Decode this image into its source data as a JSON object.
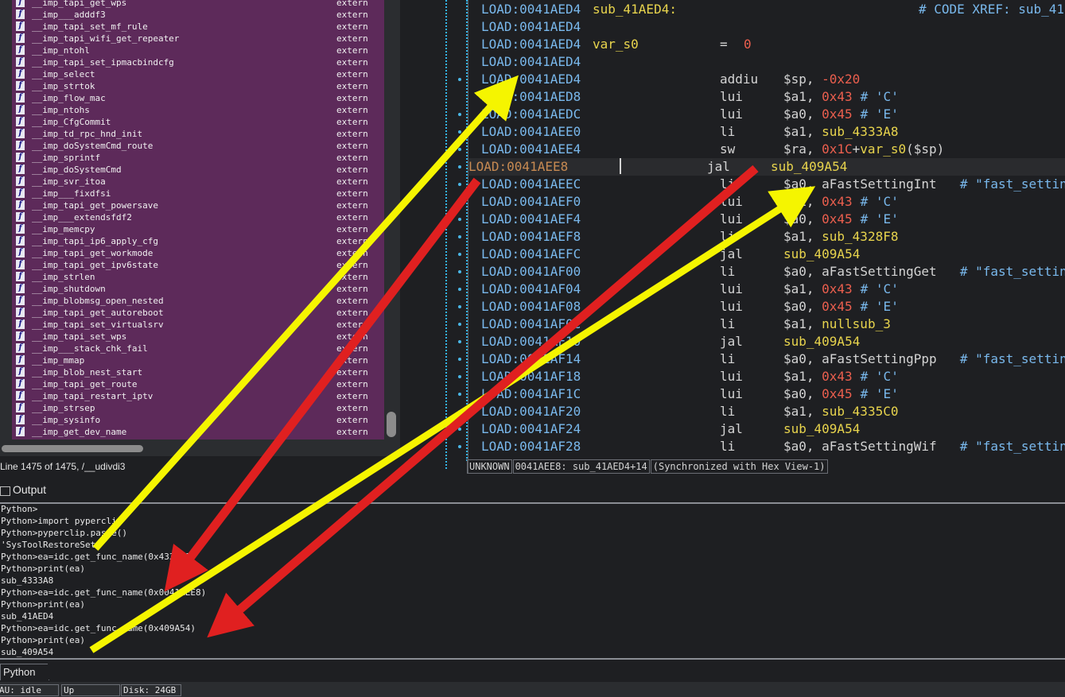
{
  "functions": {
    "rows": [
      {
        "name": "__imp_tapi_get_wps",
        "segment": "extern"
      },
      {
        "name": "__imp___adddf3",
        "segment": "extern"
      },
      {
        "name": "__imp_tapi_set_mf_rule",
        "segment": "extern"
      },
      {
        "name": "__imp_tapi_wifi_get_repeater",
        "segment": "extern"
      },
      {
        "name": "__imp_ntohl",
        "segment": "extern"
      },
      {
        "name": "__imp_tapi_set_ipmacbindcfg",
        "segment": "extern"
      },
      {
        "name": "__imp_select",
        "segment": "extern"
      },
      {
        "name": "__imp_strtok",
        "segment": "extern"
      },
      {
        "name": "__imp_flow_mac",
        "segment": "extern"
      },
      {
        "name": "__imp_ntohs",
        "segment": "extern"
      },
      {
        "name": "__imp_CfgCommit",
        "segment": "extern"
      },
      {
        "name": "__imp_td_rpc_hnd_init",
        "segment": "extern"
      },
      {
        "name": "__imp_doSystemCmd_route",
        "segment": "extern"
      },
      {
        "name": "__imp_sprintf",
        "segment": "extern"
      },
      {
        "name": "__imp_doSystemCmd",
        "segment": "extern"
      },
      {
        "name": "__imp_svr_itoa",
        "segment": "extern"
      },
      {
        "name": "__imp___fixdfsi",
        "segment": "extern"
      },
      {
        "name": "__imp_tapi_get_powersave",
        "segment": "extern"
      },
      {
        "name": "__imp___extendsfdf2",
        "segment": "extern"
      },
      {
        "name": "__imp_memcpy",
        "segment": "extern"
      },
      {
        "name": "__imp_tapi_ip6_apply_cfg",
        "segment": "extern"
      },
      {
        "name": "__imp_tapi_get_workmode",
        "segment": "extern"
      },
      {
        "name": "__imp_tapi_get_ipv6state",
        "segment": "extern"
      },
      {
        "name": "__imp_strlen",
        "segment": "extern"
      },
      {
        "name": "__imp_shutdown",
        "segment": "extern"
      },
      {
        "name": "__imp_blobmsg_open_nested",
        "segment": "extern"
      },
      {
        "name": "__imp_tapi_get_autoreboot",
        "segment": "extern"
      },
      {
        "name": "__imp_tapi_set_virtualsrv",
        "segment": "extern"
      },
      {
        "name": "__imp_tapi_set_wps",
        "segment": "extern"
      },
      {
        "name": "__imp___stack_chk_fail",
        "segment": "extern"
      },
      {
        "name": "__imp_mmap",
        "segment": "extern"
      },
      {
        "name": "__imp_blob_nest_start",
        "segment": "extern"
      },
      {
        "name": "__imp_tapi_get_route",
        "segment": "extern"
      },
      {
        "name": "__imp_tapi_restart_iptv",
        "segment": "extern"
      },
      {
        "name": "__imp_strsep",
        "segment": "extern"
      },
      {
        "name": "__imp_sysinfo",
        "segment": "extern"
      },
      {
        "name": "__imp_get_dev_name",
        "segment": "extern"
      }
    ],
    "line_info": "Line 1475 of 1475, /__udivdi3"
  },
  "disasm": {
    "lines": [
      {
        "addr": "LOAD:0041AED4",
        "label": "sub_41AED4:",
        "comment": "# CODE XREF: sub_41"
      },
      {
        "addr": "LOAD:0041AED4"
      },
      {
        "addr": "LOAD:0041AED4",
        "label": "var_s0",
        "mnem": "=",
        "num": "0"
      },
      {
        "addr": "LOAD:0041AED4"
      },
      {
        "addr": "LOAD:0041AED4",
        "mnem": "addiu",
        "op": "$sp, ",
        "num": "-0x20"
      },
      {
        "addr": "LOAD:0041AED8",
        "mnem": "lui",
        "op": "$a1, ",
        "num": "0x43",
        "comment": "# 'C'"
      },
      {
        "addr": "LOAD:0041AEDC",
        "mnem": "lui",
        "op": "$a0, ",
        "num": "0x45",
        "comment": "# 'E'"
      },
      {
        "addr": "LOAD:0041AEE0",
        "mnem": "li",
        "op": "$a1, ",
        "sym": "sub_4333A8"
      },
      {
        "addr": "LOAD:0041AEE4",
        "mnem": "sw",
        "op": "$ra, ",
        "num": "0x1C",
        "op2": "+",
        "sym": "var_s0",
        "op3": "($sp)"
      },
      {
        "addr": "LOAD:0041AEE8",
        "mnem": "jal",
        "sym": "sub_409A54"
      },
      {
        "addr": "LOAD:0041AEEC",
        "mnem": "li",
        "op": "$a0, aFastSettingInt  ",
        "comment": "# \"fast_settin"
      },
      {
        "addr": "LOAD:0041AEF0",
        "mnem": "lui",
        "op": "$a1, ",
        "num": "0x43",
        "comment": "# 'C'"
      },
      {
        "addr": "LOAD:0041AEF4",
        "mnem": "lui",
        "op": "$a0, ",
        "num": "0x45",
        "comment": "# 'E'"
      },
      {
        "addr": "LOAD:0041AEF8",
        "mnem": "li",
        "op": "$a1, ",
        "sym": "sub_4328F8"
      },
      {
        "addr": "LOAD:0041AEFC",
        "mnem": "jal",
        "sym": "sub_409A54"
      },
      {
        "addr": "LOAD:0041AF00",
        "mnem": "li",
        "op": "$a0, aFastSettingGet  ",
        "comment": "# \"fast_settin"
      },
      {
        "addr": "LOAD:0041AF04",
        "mnem": "lui",
        "op": "$a1, ",
        "num": "0x43",
        "comment": "# 'C'"
      },
      {
        "addr": "LOAD:0041AF08",
        "mnem": "lui",
        "op": "$a0, ",
        "num": "0x45",
        "comment": "# 'E'"
      },
      {
        "addr": "LOAD:0041AF0C",
        "mnem": "li",
        "op": "$a1, ",
        "sym": "nullsub_3"
      },
      {
        "addr": "LOAD:0041AF10",
        "mnem": "jal",
        "sym": "sub_409A54"
      },
      {
        "addr": "LOAD:0041AF14",
        "mnem": "li",
        "op": "$a0, aFastSettingPpp  ",
        "comment": "# \"fast_settin"
      },
      {
        "addr": "LOAD:0041AF18",
        "mnem": "lui",
        "op": "$a1, ",
        "num": "0x43",
        "comment": "# 'C'"
      },
      {
        "addr": "LOAD:0041AF1C",
        "mnem": "lui",
        "op": "$a0, ",
        "num": "0x45",
        "comment": "# 'E'"
      },
      {
        "addr": "LOAD:0041AF20",
        "mnem": "li",
        "op": "$a1, ",
        "sym": "sub_4335C0"
      },
      {
        "addr": "LOAD:0041AF24",
        "mnem": "jal",
        "sym": "sub_409A54"
      },
      {
        "addr": "LOAD:0041AF28",
        "mnem": "li",
        "op": "$a0, aFastSettingWif  ",
        "comment": "# \"fast_settin"
      }
    ],
    "status": [
      "UNKNOWN",
      "0041AEE8: sub_41AED4+14",
      "(Synchronized with Hex View-1)"
    ]
  },
  "output": {
    "title": "Output",
    "lines": [
      "Python>",
      "Python>import pyperclip",
      "Python>pyperclip.paste()",
      "'SysToolRestoreSet'",
      "Python>ea=idc.get_func_name(0x4333A8)",
      "Python>print(ea)",
      "sub_4333A8",
      "Python>ea=idc.get_func_name(0x0041AEE8)",
      "Python>print(ea)",
      "sub_41AED4",
      "Python>ea=idc.get_func_name(0x409A54)",
      "Python>print(ea)",
      "sub_409A54"
    ],
    "tab": "Python"
  },
  "statusbar": {
    "au": "AU:  idle",
    "dir": "Up",
    "disk": "Disk: 24GB"
  },
  "colors": {
    "yellow_arrow": "#f5f500",
    "red_arrow": "#e02020",
    "functions_bg": "#5d2a5a"
  }
}
